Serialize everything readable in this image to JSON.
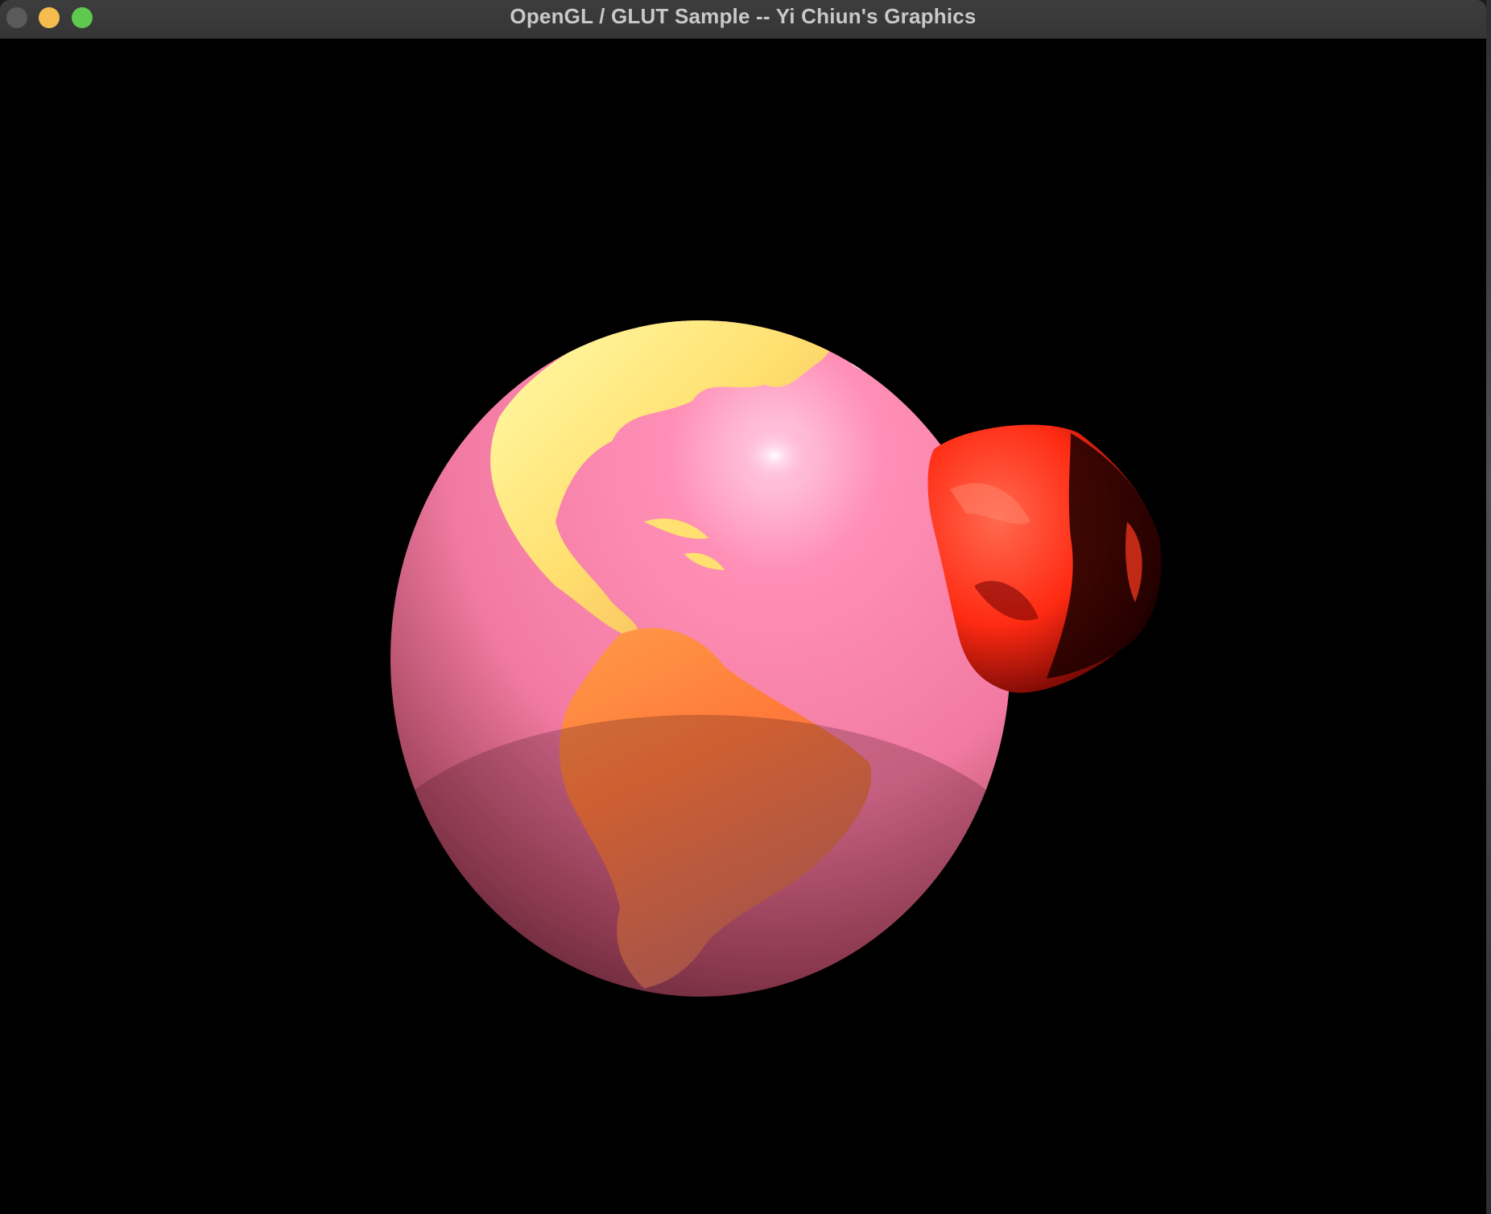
{
  "window": {
    "title": "OpenGL / GLUT Sample -- Yi Chiun's Graphics",
    "buttons": {
      "close_color": "#5a5a5a",
      "minimize_color": "#f5bd4f",
      "zoom_color": "#5fc84e"
    }
  },
  "scene": {
    "background": "#000000",
    "objects": [
      {
        "name": "earth-sphere",
        "description_icon": "planet-icon",
        "base_color": "#ff7aa3",
        "land_color": "#ff7a3a"
      },
      {
        "name": "red-moon",
        "description_icon": "moon-icon",
        "base_color": "#ff2a12"
      }
    ]
  }
}
